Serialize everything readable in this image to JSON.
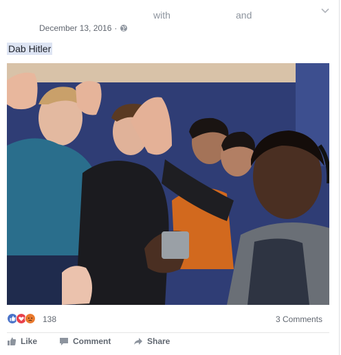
{
  "post": {
    "header": {
      "with": "with",
      "and": "and",
      "date": "December 13, 2016",
      "separator": "·"
    },
    "text": "Dab Hitler",
    "reactions": {
      "count": "138",
      "comments": "3 Comments"
    },
    "actions": {
      "like": "Like",
      "comment": "Comment",
      "share": "Share"
    }
  },
  "colors": {
    "like": "#4a73c9",
    "love": "#e9404b",
    "angry": "#ea7a2e",
    "link_bg": "#dde4f3"
  },
  "icons": {
    "privacy": "globe-icon",
    "menu": "chevron-down-icon"
  }
}
